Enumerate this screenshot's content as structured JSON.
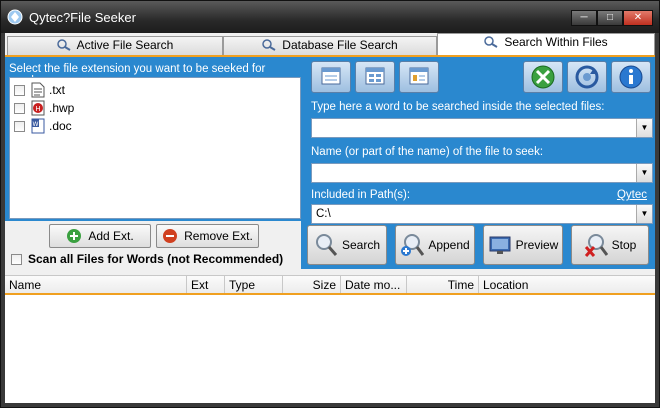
{
  "window": {
    "title": "Qytec?File Seeker"
  },
  "tabs": [
    {
      "label": "Active File Search"
    },
    {
      "label": "Database File Search"
    },
    {
      "label": "Search Within Files"
    }
  ],
  "left": {
    "label": "Select the file extension you want to be seeked for words:",
    "extensions": [
      ".txt",
      ".hwp",
      ".doc"
    ],
    "add_label": "Add Ext.",
    "remove_label": "Remove Ext.",
    "scan_all_label": "Scan all Files for Words (not Recommended)"
  },
  "right": {
    "word_label": "Type here a word to be searched inside the selected files:",
    "word_value": "",
    "name_label": "Name (or part of the name) of the file to seek:",
    "name_value": "",
    "path_label": "Included in Path(s):",
    "path_value": "C:\\",
    "link": "Qytec",
    "buttons": {
      "search": "Search",
      "append": "Append",
      "preview": "Preview",
      "stop": "Stop"
    }
  },
  "results": {
    "columns": [
      "Name",
      "Ext",
      "Type",
      "Size",
      "Date mo...",
      "Time",
      "Location"
    ]
  },
  "colors": {
    "panel": "#2a88cf",
    "accent": "#f0a020"
  }
}
